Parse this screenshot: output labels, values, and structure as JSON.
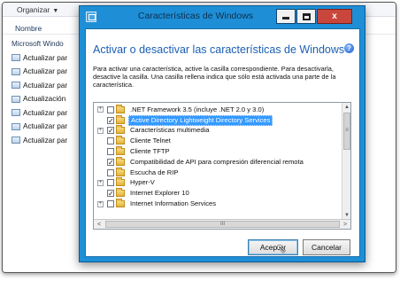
{
  "explorer": {
    "toolbar_label": "Organizar",
    "toolbar_chevron": "▼",
    "column_header": "Nombre",
    "rows": [
      {
        "label": "Microsoft Windo",
        "icon": "none"
      },
      {
        "label": "Actualizar par",
        "icon": "update-icon"
      },
      {
        "label": "Actualizar par",
        "icon": "update-icon"
      },
      {
        "label": "Actualizar par",
        "icon": "update-icon"
      },
      {
        "label": "Actualización",
        "icon": "update-icon"
      },
      {
        "label": "Actualizar par",
        "icon": "update-icon"
      },
      {
        "label": "Actualizar par",
        "icon": "update-icon"
      },
      {
        "label": "Actualizar par",
        "icon": "update-icon"
      }
    ]
  },
  "dialog": {
    "title": "Características de Windows",
    "heading": "Activar o desactivar las características de Windows",
    "help_glyph": "?",
    "description": "Para activar una característica, active la casilla correspondiente. Para desactivarla, desactive la casilla. Una casilla rellena indica que sólo está activada una parte de la característica.",
    "window_buttons": {
      "close_glyph": "x"
    },
    "features": [
      {
        "label": ".NET Framework 3.5 (incluye .NET 2.0 y 3.0)",
        "expander": "+",
        "check": "",
        "selected": false
      },
      {
        "label": "Active Directory Lightweight Directory Services",
        "expander": "",
        "check": "✓",
        "selected": true
      },
      {
        "label": "Características multimedia",
        "expander": "+",
        "check": "✓",
        "selected": false
      },
      {
        "label": "Cliente Telnet",
        "expander": "",
        "check": "",
        "selected": false
      },
      {
        "label": "Cliente TFTP",
        "expander": "",
        "check": "",
        "selected": false
      },
      {
        "label": "Compatibilidad de API para compresión diferencial remota",
        "expander": "",
        "check": "✓",
        "selected": false
      },
      {
        "label": "Escucha de RIP",
        "expander": "",
        "check": "",
        "selected": false
      },
      {
        "label": "Hyper-V",
        "expander": "+",
        "check": "",
        "selected": false
      },
      {
        "label": "Internet Explorer 10",
        "expander": "",
        "check": "✓",
        "selected": false
      },
      {
        "label": "Internet Information Services",
        "expander": "+",
        "check": "",
        "selected": false
      }
    ],
    "scroll_glyphs": {
      "up": "▲",
      "down": "▼",
      "left": "<",
      "right": ">",
      "v_grip": "≡",
      "h_grip": "III"
    },
    "accept_label": "Aceptar",
    "cancel_label": "Cancelar",
    "cursor_glyph": "⇖"
  },
  "colors": {
    "dialog_frame": "#1e8fd6",
    "heading": "#1a5fb4",
    "selection": "#3399ff",
    "close_button": "#c9463d"
  }
}
